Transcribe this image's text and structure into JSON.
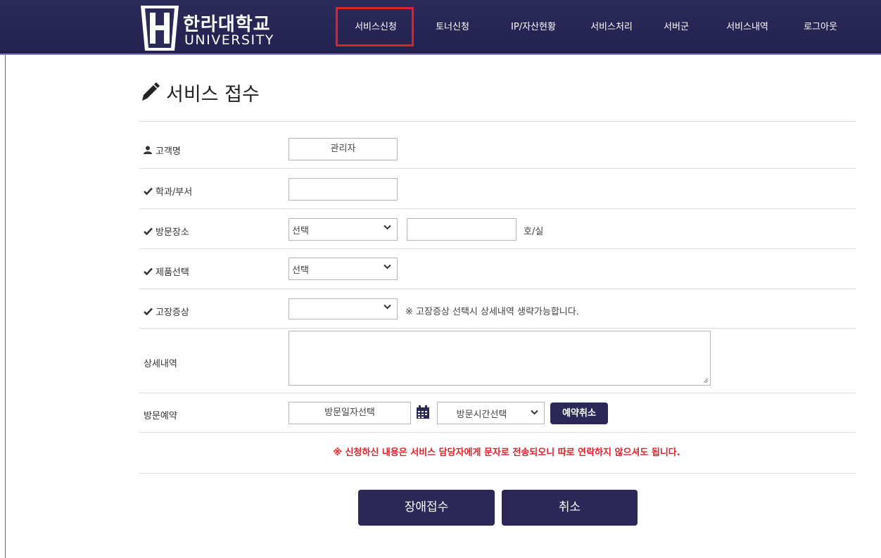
{
  "logo": {
    "korean": "한라대학교",
    "english": "UNIVERSITY"
  },
  "nav": {
    "items": [
      "서비스신청",
      "토너신청",
      "IP/자산현황",
      "서비스처리",
      "서버군",
      "서비스내역",
      "로그아웃"
    ],
    "active": "서비스신청"
  },
  "page": {
    "title": "서비스 접수"
  },
  "form": {
    "customer": {
      "label": "고객명",
      "value": "관리자"
    },
    "department": {
      "label": "학과/부서",
      "value": ""
    },
    "visit_place": {
      "label": "방문장소",
      "select": "선택",
      "room_value": "",
      "room_suffix": "호/실"
    },
    "product": {
      "label": "제품선택",
      "select": "선택"
    },
    "symptom": {
      "label": "고장증상",
      "select": "",
      "note": "※ 고장증상 선택시 상세내역 생략가능합니다."
    },
    "details": {
      "label": "상세내역",
      "value": ""
    },
    "reservation": {
      "label": "방문예약",
      "date_button": "방문일자선택",
      "time_select": "방문시간선택",
      "cancel_button": "예약취소"
    }
  },
  "notice": "※ 신청하신 내용은 서비스 담당자에게 문자로 전송되오니 따로 연락하지 않으셔도 됩니다.",
  "buttons": {
    "submit": "장애접수",
    "cancel": "취소"
  },
  "colors": {
    "navy": "#2b2858",
    "warning": "#e0202a",
    "highlight": "#e0202a"
  }
}
